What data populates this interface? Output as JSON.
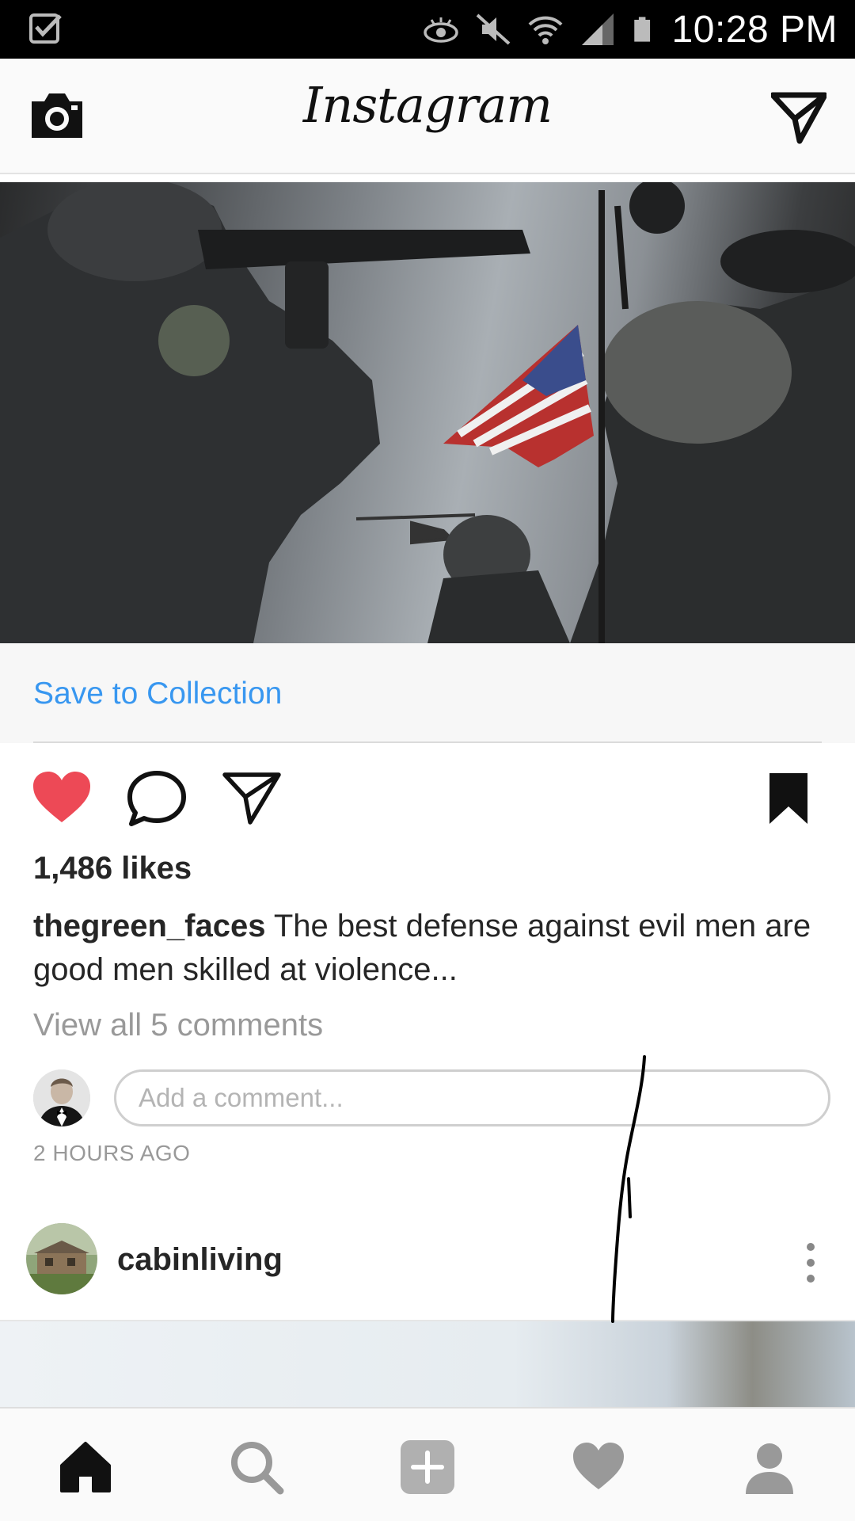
{
  "status_bar": {
    "time": "10:28 PM",
    "icons": [
      "check-notification-icon",
      "eye-icon",
      "mute-icon",
      "wifi-icon",
      "signal-icon",
      "battery-icon"
    ]
  },
  "header": {
    "title": "Instagram",
    "left_icon": "camera-icon",
    "right_icon": "direct-message-icon"
  },
  "post": {
    "image_icon": "post-photo",
    "save_to_collection": "Save to Collection",
    "actions": [
      "like-icon",
      "comment-icon",
      "share-icon",
      "bookmark-icon"
    ],
    "liked": true,
    "likes": "1,486 likes",
    "caption_user": "thegreen_faces",
    "caption_text": " The best defense against evil men are good men skilled at violence...",
    "view_comments": "View all 5 comments",
    "comment_placeholder": "Add a comment...",
    "timestamp": "2 HOURS AGO"
  },
  "next_post": {
    "username": "cabinliving",
    "more_icon": "more-vertical-icon"
  },
  "bottom_nav": {
    "items": [
      "home-icon",
      "search-icon",
      "add-post-icon",
      "activity-heart-icon",
      "profile-icon"
    ],
    "active": "home-icon"
  },
  "colors": {
    "link_blue": "#3897f0",
    "like_red": "#ed4956",
    "text": "#262626",
    "muted": "#999999"
  }
}
